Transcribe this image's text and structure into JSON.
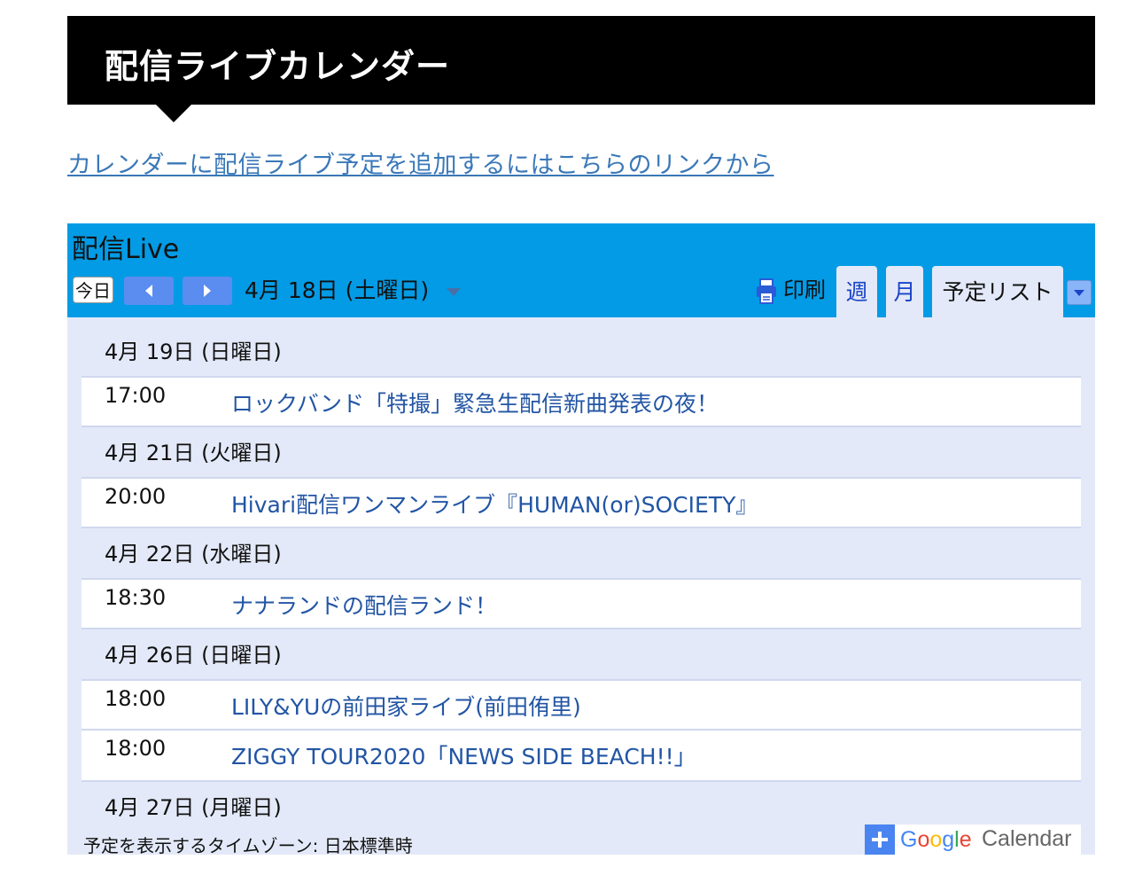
{
  "page": {
    "title": "配信ライブカレンダー",
    "add_link": "カレンダーに配信ライブ予定を追加するにはこちらのリンクから"
  },
  "calendar": {
    "title": "配信Live",
    "toolbar": {
      "today_label": "今日",
      "current_date": "4月 18日 (土曜日)",
      "print_label": "印刷",
      "tabs": [
        {
          "label": "週"
        },
        {
          "label": "月"
        },
        {
          "label": "予定リスト",
          "selected": true
        }
      ]
    },
    "agenda": [
      {
        "date": "4月 19日 (日曜日)",
        "events": [
          {
            "time": "17:00",
            "title": "ロックバンド「特撮」緊急生配信新曲発表の夜！"
          }
        ]
      },
      {
        "date": "4月 21日 (火曜日)",
        "events": [
          {
            "time": "20:00",
            "title": "Hivari配信ワンマンライブ『HUMAN(or)SOCIETY』"
          }
        ]
      },
      {
        "date": "4月 22日 (水曜日)",
        "events": [
          {
            "time": "18:30",
            "title": "ナナランドの配信ランド！"
          }
        ]
      },
      {
        "date": "4月 26日 (日曜日)",
        "events": [
          {
            "time": "18:00",
            "title": "LILY&YUの前田家ライブ(前田侑里)"
          },
          {
            "time": "18:00",
            "title": "ZIGGY TOUR2020「NEWS SIDE BEACH!!」"
          }
        ]
      },
      {
        "date": "4月 27日 (月曜日)",
        "events": []
      }
    ],
    "footer": {
      "timezone_text": "予定を表示するタイムゾーン: 日本標準時",
      "gcal_word": "Google",
      "gcal_calendar": "Calendar"
    }
  },
  "colors": {
    "header_bg": "#039be5",
    "agenda_bg": "#e3e9f8",
    "event_link": "#2255a4",
    "nav_button": "#5b8cf0",
    "page_link": "#3a78b8"
  }
}
